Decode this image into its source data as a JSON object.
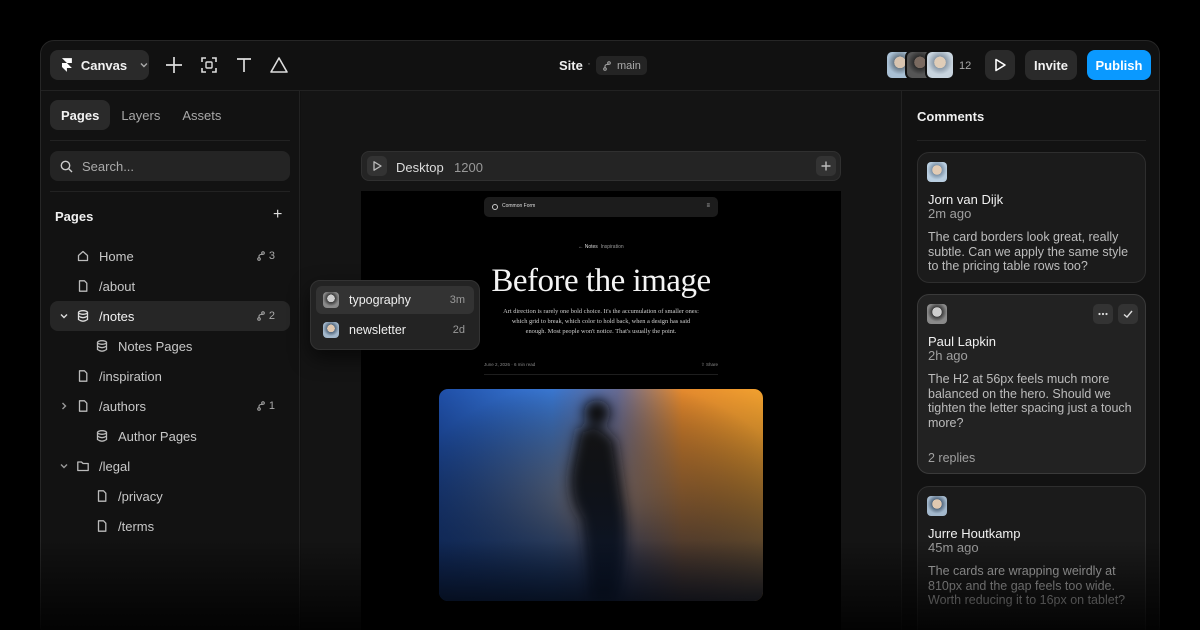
{
  "topbar": {
    "canvas_label": "Canvas",
    "site_title": "Site",
    "separator": "·",
    "branch": "main",
    "collaborator_count": "12",
    "invite_label": "Invite",
    "publish_label": "Publish"
  },
  "left_panel": {
    "tabs": [
      {
        "label": "Pages"
      },
      {
        "label": "Layers"
      },
      {
        "label": "Assets"
      }
    ],
    "search_placeholder": "Search...",
    "pages_header": "Pages",
    "add_symbol": "+",
    "tree": [
      {
        "label": "Home",
        "icon": "home-icon",
        "badge": "3"
      },
      {
        "label": "/about",
        "icon": "page-icon"
      },
      {
        "label": "/notes",
        "icon": "database-icon",
        "badge": "2",
        "expanded": true,
        "selected": true
      },
      {
        "label": "Notes Pages",
        "icon": "database-icon",
        "indent": true
      },
      {
        "label": "/inspiration",
        "icon": "page-icon"
      },
      {
        "label": "/authors",
        "icon": "page-icon",
        "badge": "1",
        "collapsed": true
      },
      {
        "label": "Author Pages",
        "icon": "database-icon",
        "indent": true
      },
      {
        "label": "/legal",
        "icon": "folder-icon",
        "expanded": true
      },
      {
        "label": "/privacy",
        "icon": "page-icon",
        "indent": true
      },
      {
        "label": "/terms",
        "icon": "page-icon",
        "indent": true
      }
    ]
  },
  "canvas": {
    "frame_name": "Desktop",
    "frame_width": "1200",
    "preview": {
      "brand": "Common Form",
      "menu": "≡",
      "crumb_back": "← Notes",
      "crumb_current": "Inspiration",
      "title": "Before the image",
      "subtitle": "Art direction is rarely one bold choice. It's the accumulation of smaller ones: which grid to break, which color to hold back, when a design has said enough. Most people won't notice. That's usually the point.",
      "meta_left": "June 2, 2026  ·  6 min read",
      "meta_right": "⇧ Share"
    },
    "popover": [
      {
        "label": "typography",
        "time": "3m"
      },
      {
        "label": "newsletter",
        "time": "2d"
      }
    ]
  },
  "comments_panel": {
    "title": "Comments",
    "comments": [
      {
        "name": "Jorn van Dijk",
        "time": "2m ago",
        "text": "The card borders look great, really subtle. Can we apply the same style to the pricing table rows too?"
      },
      {
        "name": "Paul Lapkin",
        "time": "2h ago",
        "text": "The H2 at 56px feels much more balanced on the hero. Should we tighten the letter spacing just a touch more?",
        "replies": "2 replies"
      },
      {
        "name": "Jurre Houtkamp",
        "time": "45m ago",
        "text": "The cards are wrapping weirdly at 810px and the gap feels too wide. Worth reducing it to 16px on tablet?"
      }
    ]
  },
  "colors": {
    "accent": "#0a99ff",
    "background": "#111111",
    "panel": "#121212"
  }
}
